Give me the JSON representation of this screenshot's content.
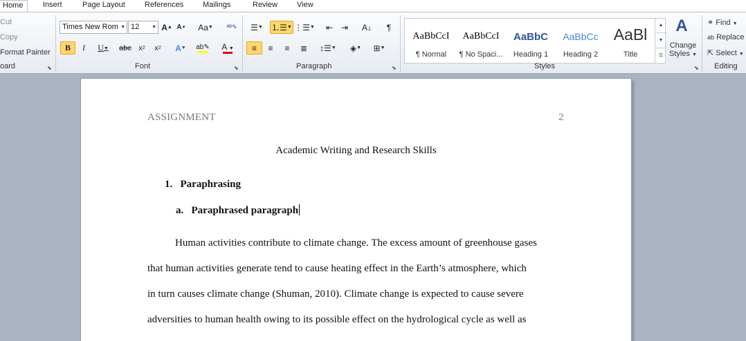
{
  "tabs": [
    "Home",
    "Insert",
    "Page Layout",
    "References",
    "Mailings",
    "Review",
    "View"
  ],
  "clipboard": {
    "cut": "Cut",
    "copy": "Copy",
    "format_painter": "Format Painter",
    "group": "oard"
  },
  "font": {
    "name": "Times New Rom",
    "size": "12",
    "group": "Font"
  },
  "paragraph": {
    "group": "Paragraph"
  },
  "styles": {
    "items": [
      {
        "sample": "AaBbCcI",
        "name": "¶ Normal"
      },
      {
        "sample": "AaBbCcI",
        "name": "¶ No Spaci..."
      },
      {
        "sample": "AaBbC",
        "name": "Heading 1"
      },
      {
        "sample": "AaBbCc",
        "name": "Heading 2"
      },
      {
        "sample": "AaBl",
        "name": "Title"
      }
    ],
    "change_styles": "Change Styles",
    "group": "Styles"
  },
  "editing": {
    "find": "Find",
    "replace": "Replace",
    "select": "Select",
    "group": "Editing"
  },
  "colors": {
    "accent": "#ffd66b",
    "heading_blue": "#2f5597",
    "highlight": "#ffff00",
    "font_red": "#e00000"
  },
  "document": {
    "header_left": "ASSIGNMENT",
    "header_right": "2",
    "title": "Academic Writing and Research Skills",
    "list1_num": "1.",
    "list1_text": "Paraphrasing",
    "list2_num": "a.",
    "list2_text": "Paraphrased paragraph",
    "lines": [
      "Human activities contribute to climate change. The excess amount of greenhouse gases",
      "that human activities generate tend to cause heating effect in the Earth’s atmosphere, which",
      "in turn causes climate change (Shuman, 2010). Climate change is expected to cause severe",
      "adversities to human health owing to its possible  effect on the hydrological cycle as well as"
    ]
  }
}
